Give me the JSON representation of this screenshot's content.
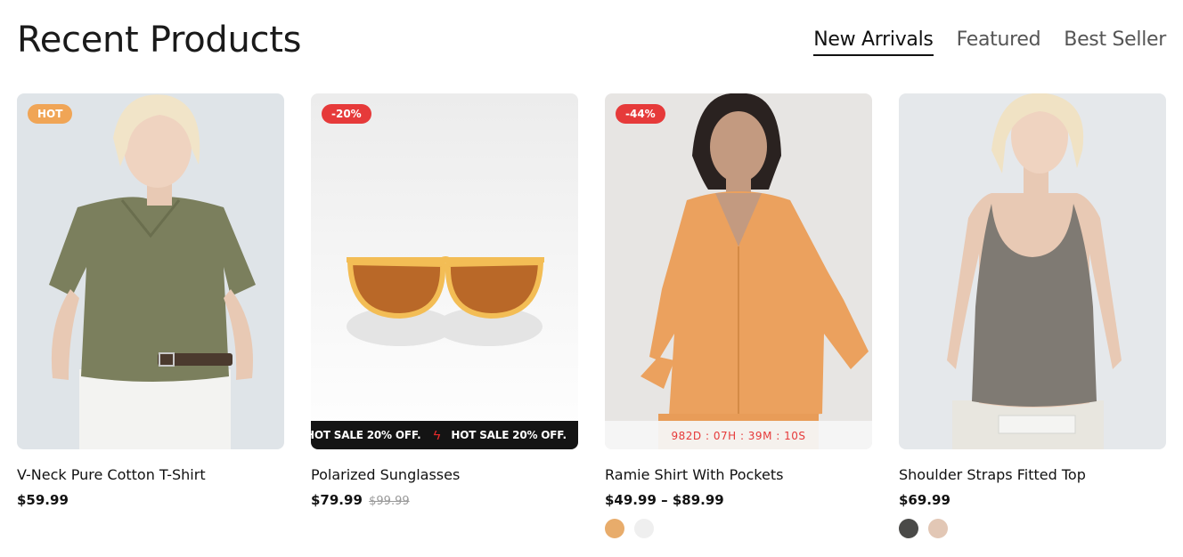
{
  "section": {
    "title": "Recent Products",
    "tabs": [
      {
        "label": "New Arrivals",
        "active": true
      },
      {
        "label": "Featured",
        "active": false
      },
      {
        "label": "Best Seller",
        "active": false
      }
    ]
  },
  "products": [
    {
      "name": "V-Neck Pure Cotton T-Shirt",
      "badge": "HOT",
      "price": "$59.99"
    },
    {
      "name": "Polarized Sunglasses",
      "badge": "-20%",
      "price": "$79.99",
      "old_price": "$99.99",
      "marquee": {
        "text": "HOT SALE 20% OFF."
      }
    },
    {
      "name": "Ramie Shirt With Pockets",
      "badge": "-44%",
      "price": "$49.99 – $89.99",
      "countdown": "982D : 07H : 39M : 10S",
      "swatches": [
        "#e8ac6b",
        "#efefef"
      ]
    },
    {
      "name": "Shoulder Straps Fitted Top",
      "price": "$69.99",
      "swatches": [
        "#4a4a48",
        "#e2c7b5"
      ]
    }
  ],
  "icons": {
    "marquee_separator": "lightning-bolt-icon"
  },
  "colors": {
    "hot_badge": "#f0a556",
    "sale_badge": "#e63a3a",
    "countdown_text": "#e63a3a"
  }
}
